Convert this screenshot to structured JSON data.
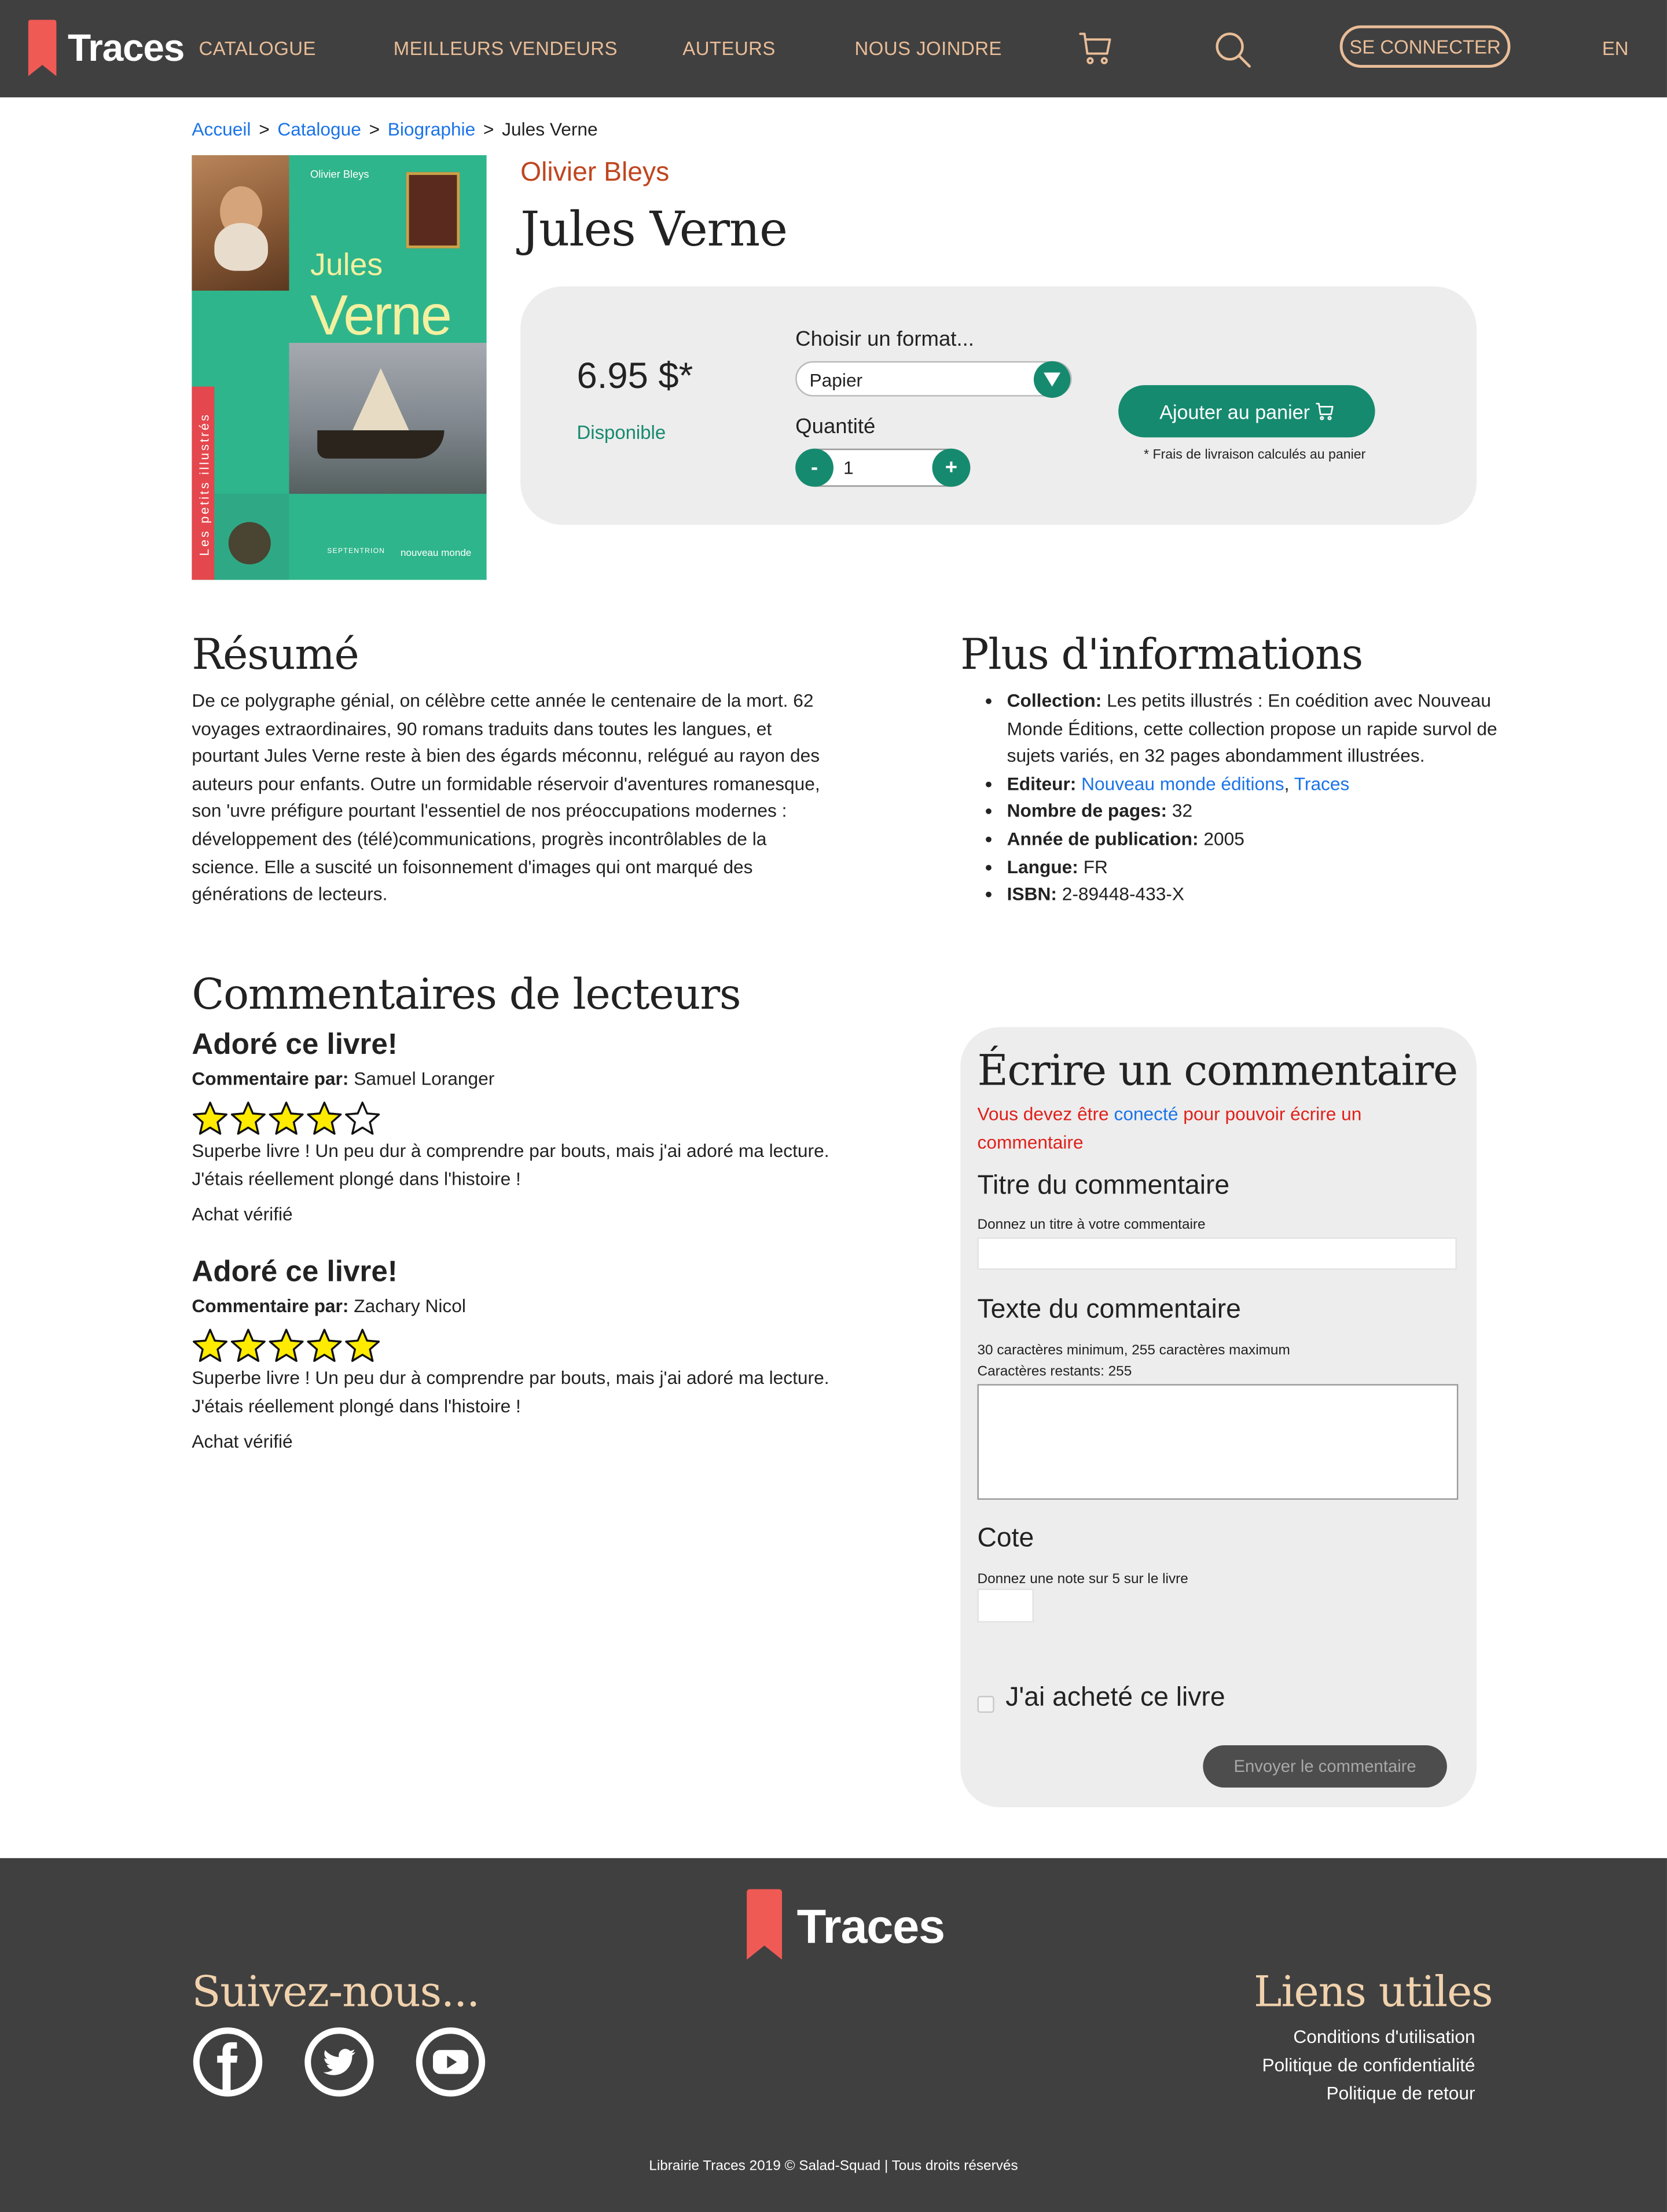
{
  "brand": {
    "name": "Traces",
    "accent": "#ef5a55",
    "teal": "#168a6f",
    "header_bg": "#404040",
    "nav_color": "#e9bd98"
  },
  "nav": {
    "items": [
      "CATALOGUE",
      "MEILLEURS VENDEURS",
      "AUTEURS",
      "NOUS JOINDRE"
    ],
    "cart_icon": "cart-icon",
    "search_icon": "search-icon",
    "login": "SE CONNECTER",
    "lang": "EN"
  },
  "breadcrumb": {
    "links": [
      "Accueil",
      "Catalogue",
      "Biographie"
    ],
    "separator": ">",
    "current": "Jules Verne"
  },
  "cover": {
    "author": "Olivier Bleys",
    "title_line1": "Jules",
    "title_line2": "Verne",
    "collection": "Les petits illustrés",
    "publisher1": "SEPTENTRION",
    "publisher2": "nouveau monde"
  },
  "book": {
    "author": "Olivier Bleys",
    "title": "Jules Verne"
  },
  "purchase": {
    "price": "6.95 $*",
    "availability": "Disponible",
    "format_label": "Choisir un format...",
    "format_value": "Papier",
    "quantity_label": "Quantité",
    "quantity_minus": "-",
    "quantity_value": "1",
    "quantity_plus": "+",
    "add_to_cart": "Ajouter au panier",
    "shipping_note": "* Frais de livraison calculés au panier"
  },
  "resume": {
    "heading": "Résumé",
    "text": "De ce polygraphe génial, on célèbre cette année le centenaire de la mort. 62 voyages extraordinaires, 90 romans traduits dans toutes les langues, et pourtant Jules Verne reste à bien des égards méconnu, relégué au rayon des auteurs pour enfants. Outre un formidable réservoir d'aventures romanesque, son 'uvre préfigure pourtant l'essentiel de nos préoccupations modernes : développement des (télé)communications, progrès incontrôlables de la science. Elle a suscité un foisonnement d'images qui ont marqué des générations de lecteurs."
  },
  "info": {
    "heading": "Plus d'informations",
    "collection_label": "Collection:",
    "collection_value": "Les petits illustrés : En coédition avec Nouveau Monde Éditions, cette collection propose un rapide survol de sujets variés, en 32 pages abondamment illustrées.",
    "editor_label": "Editeur:",
    "editors": [
      "Nouveau monde éditions",
      "Traces"
    ],
    "editor_separator": ",",
    "pages_label": "Nombre de pages:",
    "pages_value": "32",
    "year_label": "Année de publication:",
    "year_value": "2005",
    "lang_label": "Langue:",
    "lang_value": "FR",
    "isbn_label": "ISBN:",
    "isbn_value": "2-89448-433-X"
  },
  "comments": {
    "heading": "Commentaires de lecteurs",
    "by_label": "Commentaire par:",
    "items": [
      {
        "title": "Adoré ce livre!",
        "author": "Samuel Loranger",
        "rating": 4,
        "text": "Superbe livre ! Un peu dur à comprendre par bouts, mais j'ai adoré ma lecture. J'étais réellement plongé dans l'histoire !",
        "verified": "Achat vérifié"
      },
      {
        "title": "Adoré ce livre!",
        "author": "Zachary Nicol",
        "rating": 5,
        "text": "Superbe livre ! Un peu dur à comprendre par bouts, mais j'ai adoré ma lecture. J'étais réellement plongé dans l'histoire !",
        "verified": "Achat vérifié"
      }
    ],
    "star_color": "#ffeb00"
  },
  "form": {
    "heading": "Écrire un commentaire",
    "warning_before": "Vous devez être",
    "warning_link": "conecté",
    "warning_after": "pour pouvoir écrire un commentaire",
    "title_label": "Titre du commentaire",
    "title_hint": "Donnez un titre à votre commentaire",
    "text_label": "Texte du commentaire",
    "text_hint1": "30 caractères minimum, 255 caractères maximum",
    "text_hint2": "Caractères restants: 255",
    "rating_label": "Cote",
    "rating_hint": "Donnez une note sur 5 sur le livre",
    "purchased_label": "J'ai acheté ce livre",
    "submit": "Envoyer le commentaire"
  },
  "footer": {
    "brand": "Traces",
    "follow_heading": "Suivez-nous...",
    "social": [
      "facebook-icon",
      "twitter-icon",
      "youtube-icon"
    ],
    "links_heading": "Liens utiles",
    "links": [
      "Conditions d'utilisation",
      "Politique de confidentialité",
      "Politique de retour"
    ],
    "copyright": "Librairie Traces 2019 © Salad-Squad | Tous droits réservés"
  }
}
